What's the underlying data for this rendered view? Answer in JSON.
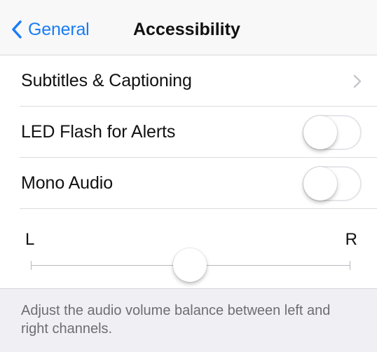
{
  "nav": {
    "back_label": "General",
    "title": "Accessibility"
  },
  "rows": [
    {
      "label": "Subtitles & Captioning",
      "accessory": "chevron-right-icon"
    },
    {
      "label": "LED Flash for Alerts",
      "accessory": "toggle",
      "on": false
    },
    {
      "label": "Mono Audio",
      "accessory": "toggle",
      "on": false
    }
  ],
  "balance": {
    "left_label": "L",
    "right_label": "R",
    "value": 0.5
  },
  "footer": {
    "text": "Adjust the audio volume balance between left and right channels."
  },
  "colors": {
    "accent": "#1a7cf5",
    "group_background": "#efeff4",
    "footer_text": "#6d6d72"
  }
}
